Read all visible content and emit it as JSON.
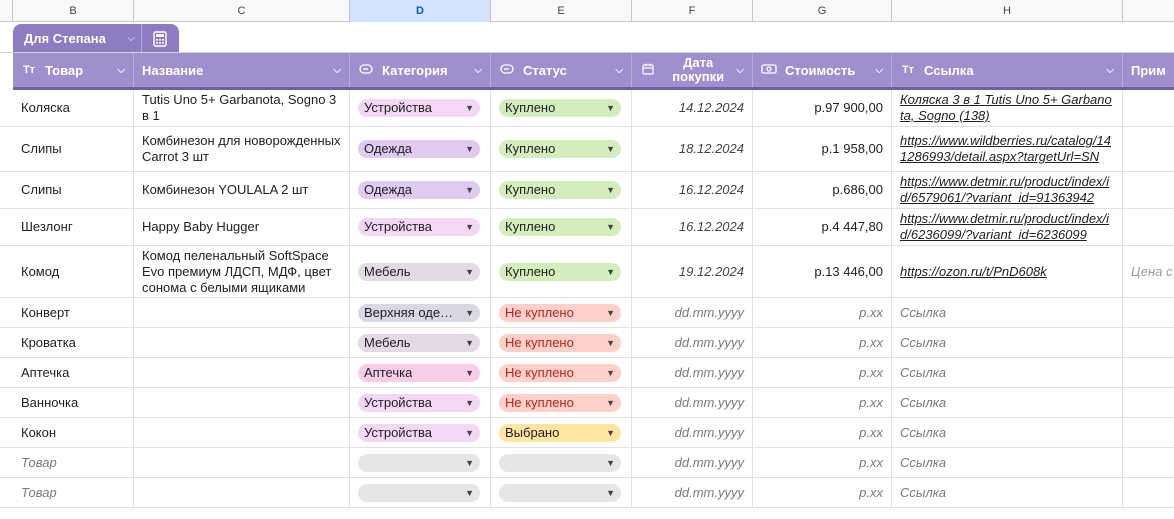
{
  "column_letters": [
    "B",
    "C",
    "D",
    "E",
    "F",
    "G",
    "H"
  ],
  "table_tab": {
    "name": "Для Степана",
    "calc_icon": "calculator-icon"
  },
  "headers": [
    {
      "icon": "Tт",
      "label": "Товар"
    },
    {
      "icon": "",
      "label": "Название"
    },
    {
      "icon": "⊂⊃",
      "label": "Категория"
    },
    {
      "icon": "⊂⊃",
      "label": "Статус"
    },
    {
      "icon": "▦",
      "label": "Дата покупки"
    },
    {
      "icon": "▭",
      "label": "Стоимость"
    },
    {
      "icon": "Tт",
      "label": "Ссылка"
    },
    {
      "icon": "",
      "label": "Примет"
    }
  ],
  "colors": {
    "header_bg": "#9e8fcd",
    "tab_bg": "#8e7cc3",
    "status_bought": "#d4edbc",
    "status_not_bought": "#ffcfc9",
    "status_chosen": "#ffe5a0",
    "cat_devices": "#f3d7f5",
    "cat_clothes": "#e0caf0",
    "cat_furniture": "#e6d9e6",
    "cat_outerwear": "#dad6e6",
    "cat_pharmacy": "#f9cdea",
    "empty_chip": "#e6e6e6"
  },
  "rows": [
    {
      "item": "Коляска",
      "name": "Tutis Uno 5+ Garbanota, Sogno 3 в 1",
      "category": "Устройства",
      "cat_color": "#f3d7f5",
      "status": "Куплено",
      "status_color": "#d4edbc",
      "date": "14.12.2024",
      "cost": "р.97 900,00",
      "link": "Коляска 3 в 1 Tutis Uno 5+ Garbanota, Sogno (138)",
      "note": ""
    },
    {
      "item": "Слипы",
      "name": "Комбинезон для новорожденных Carrot 3 шт",
      "category": "Одежда",
      "cat_color": "#e0caf0",
      "status": "Куплено",
      "status_color": "#d4edbc",
      "date": "18.12.2024",
      "cost": "р.1 958,00",
      "link": "https://www.wildberries.ru/catalog/141286993/detail.aspx?targetUrl=SN",
      "note": ""
    },
    {
      "item": "Слипы",
      "name": "Комбинезон YOULALA 2 шт",
      "category": "Одежда",
      "cat_color": "#e0caf0",
      "status": "Куплено",
      "status_color": "#d4edbc",
      "date": "16.12.2024",
      "cost": "р.686,00",
      "link": "https://www.detmir.ru/product/index/id/6579061/?variant_id=91363942",
      "note": ""
    },
    {
      "item": "Шезлонг",
      "name": "Happy Baby Hugger",
      "category": "Устройства",
      "cat_color": "#f3d7f5",
      "status": "Куплено",
      "status_color": "#d4edbc",
      "date": "16.12.2024",
      "cost": "р.4 447,80",
      "link": "https://www.detmir.ru/product/index/id/6236099/?variant_id=6236099",
      "note": ""
    },
    {
      "item": "Комод",
      "name": "Комод пеленальный SoftSpace Evo премиум ЛДСП, МДФ, цвет сонома с белыми ящиками",
      "category": "Мебель",
      "cat_color": "#e6d9e6",
      "status": "Куплено",
      "status_color": "#d4edbc",
      "date": "19.12.2024",
      "cost": "р.13 446,00",
      "link": "https://ozon.ru/t/PnD608k",
      "note": "Цена с квартир"
    },
    {
      "item": "Конверт",
      "name": "",
      "category": "Верхняя одежда",
      "cat_color": "#dad6e6",
      "status": "Не куплено",
      "status_color": "#ffcfc9",
      "date": "dd.mm.yyyy",
      "cost": "р.xx",
      "link": "Ссылка",
      "note": ""
    },
    {
      "item": "Кроватка",
      "name": "",
      "category": "Мебель",
      "cat_color": "#e6d9e6",
      "status": "Не куплено",
      "status_color": "#ffcfc9",
      "date": "dd.mm.yyyy",
      "cost": "р.xx",
      "link": "Ссылка",
      "note": ""
    },
    {
      "item": "Аптечка",
      "name": "",
      "category": "Аптечка",
      "cat_color": "#f9cdea",
      "status": "Не куплено",
      "status_color": "#ffcfc9",
      "date": "dd.mm.yyyy",
      "cost": "р.xx",
      "link": "Ссылка",
      "note": ""
    },
    {
      "item": "Ванночка",
      "name": "",
      "category": "Устройства",
      "cat_color": "#f3d7f5",
      "status": "Не куплено",
      "status_color": "#ffcfc9",
      "date": "dd.mm.yyyy",
      "cost": "р.xx",
      "link": "Ссылка",
      "note": ""
    },
    {
      "item": "Кокон",
      "name": "",
      "category": "Устройства",
      "cat_color": "#f3d7f5",
      "status": "Выбрано",
      "status_color": "#ffe5a0",
      "date": "dd.mm.yyyy",
      "cost": "р.xx",
      "link": "Ссылка",
      "note": ""
    },
    {
      "item": "Товар",
      "name": "",
      "category": "",
      "cat_color": "#e6e6e6",
      "status": "",
      "status_color": "#e6e6e6",
      "date": "dd.mm.yyyy",
      "cost": "р.xx",
      "link": "Ссылка",
      "note": ""
    },
    {
      "item": "Товар",
      "name": "",
      "category": "",
      "cat_color": "#e6e6e6",
      "status": "",
      "status_color": "#e6e6e6",
      "date": "dd.mm.yyyy",
      "cost": "р.xx",
      "link": "Ссылка",
      "note": ""
    }
  ]
}
